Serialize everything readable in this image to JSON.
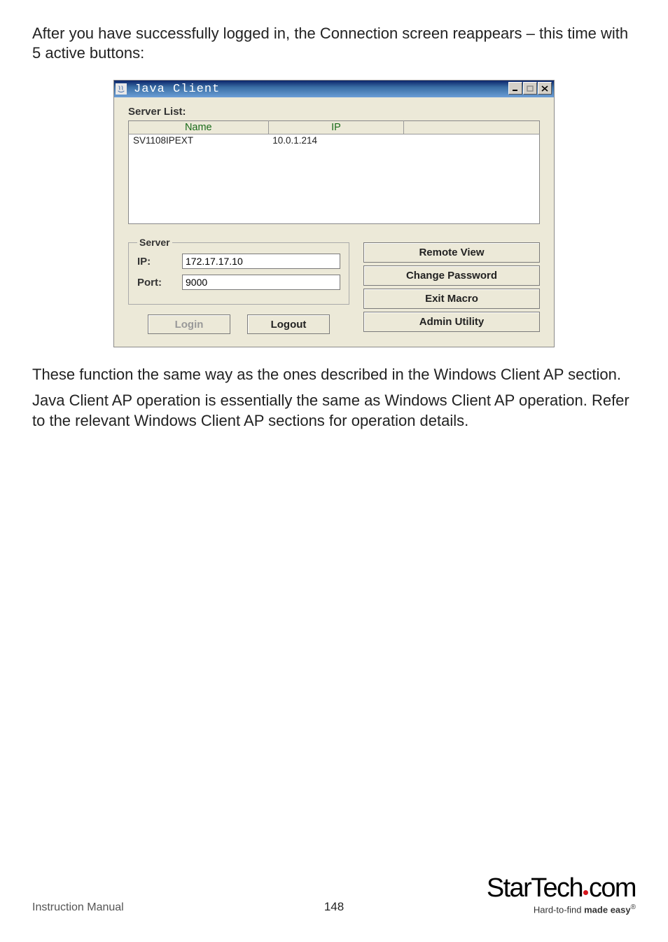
{
  "intro": "After you have successfully logged in, the Connection screen reappears – this  time with 5 active buttons:",
  "window": {
    "title": "Java Client",
    "server_list_label": "Server List:",
    "columns": {
      "c0": "Name",
      "c1": "IP",
      "c2": ""
    },
    "row": {
      "name": "SV1108IPEXT",
      "ip": "10.0.1.214"
    },
    "server_legend": "Server",
    "ip_label": "IP:",
    "ip_value": "172.17.17.10",
    "port_label": "Port:",
    "port_value": "9000",
    "login_label": "Login",
    "logout_label": "Logout",
    "btn_remote": "Remote View",
    "btn_changepw": "Change Password",
    "btn_exitmacro": "Exit Macro",
    "btn_admin": "Admin Utility"
  },
  "outro1": "These function the same way as the ones described in the Windows Client AP  section.",
  "outro2": "Java Client AP operation is essentially the same as Windows Client AP  operation. Refer to the relevant Windows Client AP sections for operation  details.",
  "footer": {
    "left": "Instruction Manual",
    "page": "148",
    "logo1": "Star",
    "logo2": "Tech",
    "logo3": "com",
    "tag1": "Hard-to-find ",
    "tag2": "made easy",
    "reg": "®"
  }
}
